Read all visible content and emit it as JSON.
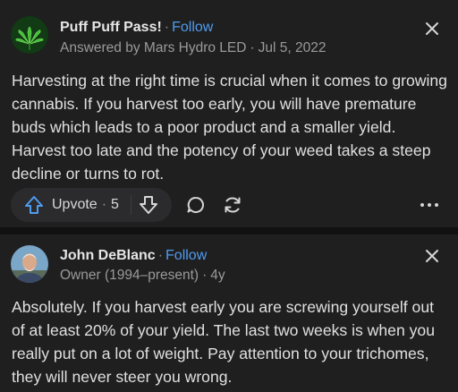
{
  "answers": [
    {
      "author": "Puff Puff Pass!",
      "follow_label": "Follow",
      "separator": "·",
      "credential": "Answered by Mars Hydro LED",
      "date": "Jul 5, 2022",
      "avatar_icon": "cannabis-leaf-icon",
      "text": "Harvesting at the right time is crucial when it comes to growing cannabis. If you harvest too early, you will have premature buds which leads to a poor product and a smaller yield. Harvest too late and the potency of your weed takes a steep decline or turns to rot.",
      "upvote_label": "Upvote",
      "upvote_count": "5"
    },
    {
      "author": "John DeBlanc",
      "follow_label": "Follow",
      "separator": "·",
      "credential": "Owner (1994–present)",
      "date": "4y",
      "avatar_icon": "profile-photo-icon",
      "text": "Absolutely. If you harvest early you are screwing yourself out of at least 20% of your yield. The last two weeks is when you really put on a lot of weight. Pay attention to your trichomes, they will never steer you wrong."
    }
  ],
  "colors": {
    "background": "#1a1a1b",
    "card": "#1f1f20",
    "accent": "#4e9cf0",
    "upvote_icon": "#4e9cf0",
    "muted_text": "#9a9a9a"
  }
}
